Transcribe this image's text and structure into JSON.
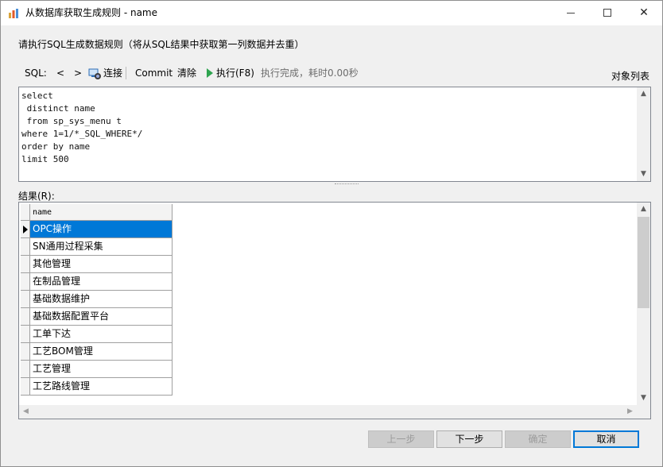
{
  "window": {
    "title": "从数据库获取生成规则 - name",
    "controls": {
      "minimize": "minimize",
      "maximize": "maximize",
      "close": "✕"
    }
  },
  "description": "请执行SQL生成数据规则（将从SQL结果中获取第一列数据并去重）",
  "toolbar": {
    "sql_label": "SQL:",
    "prev": "<",
    "next": ">",
    "connect": "连接",
    "commit": "Commit",
    "clear": "清除",
    "execute": "执行(F8)",
    "status": "执行完成，耗时0.00秒"
  },
  "object_list": "对象列表",
  "sql_text": "select\n distinct name\n from sp_sys_menu t\nwhere 1=1/*_SQL_WHERE*/\norder by name\nlimit 500",
  "result": {
    "label": "结果(R):",
    "column": "name",
    "rows": [
      "OPC操作",
      "SN通用过程采集",
      "其他管理",
      "在制品管理",
      "基础数据维护",
      "基础数据配置平台",
      "工单下达",
      "工艺BOM管理",
      "工艺管理",
      "工艺路线管理"
    ],
    "selected_index": 0
  },
  "buttons": {
    "prev_step": "上一步",
    "next_step": "下一步",
    "ok": "确定",
    "cancel": "取消"
  },
  "colors": {
    "selection": "#0078d7",
    "execute_icon": "#2ea44f"
  }
}
